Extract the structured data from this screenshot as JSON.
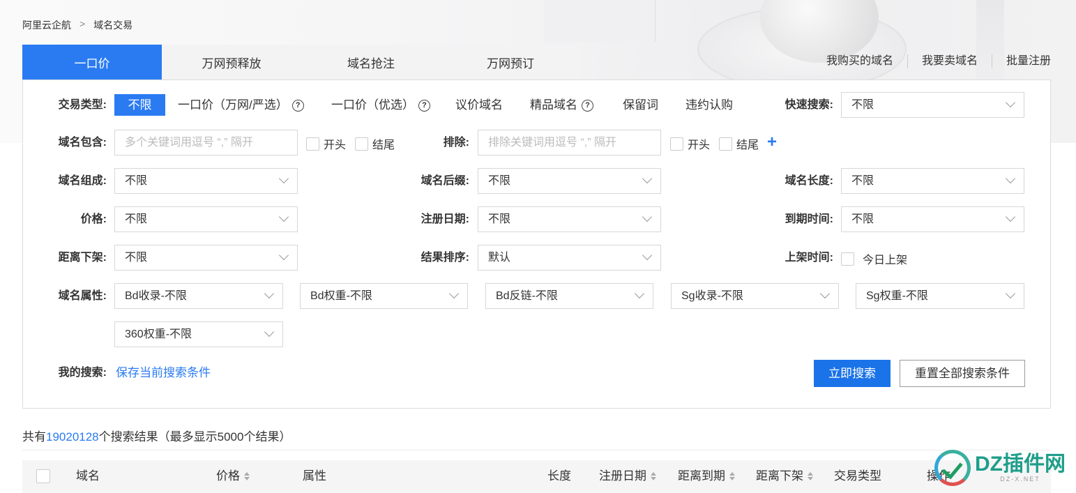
{
  "breadcrumb": {
    "home": "阿里云企航",
    "sep": ">",
    "current": "域名交易"
  },
  "tabs": [
    {
      "label": "一口价",
      "active": true
    },
    {
      "label": "万网预释放"
    },
    {
      "label": "域名抢注"
    },
    {
      "label": "万网预订"
    }
  ],
  "top_links": [
    "我购买的域名",
    "我要卖域名",
    "批量注册"
  ],
  "filters": {
    "trade_type": {
      "label": "交易类型:",
      "selected": "不限",
      "options": [
        "一口价（万网/严选）",
        "一口价（优选）",
        "议价域名",
        "精品域名",
        "保留词",
        "违约认购"
      ],
      "help": "?"
    },
    "quick_search": {
      "label": "快速搜索:",
      "value": "不限"
    },
    "contains": {
      "label": "域名包含:",
      "placeholder": "多个关键词用逗号 “,” 隔开",
      "start": "开头",
      "end": "结尾"
    },
    "exclude": {
      "label": "排除:",
      "placeholder": "排除关键词用逗号 “,” 隔开",
      "start": "开头",
      "end": "结尾",
      "add": "+"
    },
    "composition": {
      "label": "域名组成:",
      "value": "不限"
    },
    "suffix": {
      "label": "域名后缀:",
      "value": "不限"
    },
    "length": {
      "label": "域名长度:",
      "value": "不限"
    },
    "price": {
      "label": "价格:",
      "value": "不限"
    },
    "reg_date": {
      "label": "注册日期:",
      "value": "不限"
    },
    "expire": {
      "label": "到期时间:",
      "value": "不限"
    },
    "offshelf": {
      "label": "距离下架:",
      "value": "不限"
    },
    "sort": {
      "label": "结果排序:",
      "value": "默认"
    },
    "onshelf": {
      "label": "上架时间:",
      "today": "今日上架"
    },
    "attrs": {
      "label": "域名属性:",
      "items": [
        "Bd收录-不限",
        "Bd权重-不限",
        "Bd反链-不限",
        "Sg收录-不限",
        "Sg权重-不限",
        "360权重-不限"
      ]
    },
    "my_search": {
      "label": "我的搜索:",
      "save": "保存当前搜索条件"
    },
    "search_btn": "立即搜索",
    "reset_btn": "重置全部搜索条件"
  },
  "results": {
    "prefix": "共有",
    "count": "19020128",
    "suffix": "个搜索结果（最多显示5000个结果）"
  },
  "table": {
    "headers": [
      "域名",
      "价格",
      "属性",
      "长度",
      "注册日期",
      "距离到期",
      "距离下架",
      "交易类型",
      "操作"
    ]
  },
  "watermark": {
    "title": "DZ插件网",
    "sub": "DZ-X.NET"
  },
  "colors": {
    "accent": "#2a7bf2",
    "button": "#1a73e8"
  }
}
